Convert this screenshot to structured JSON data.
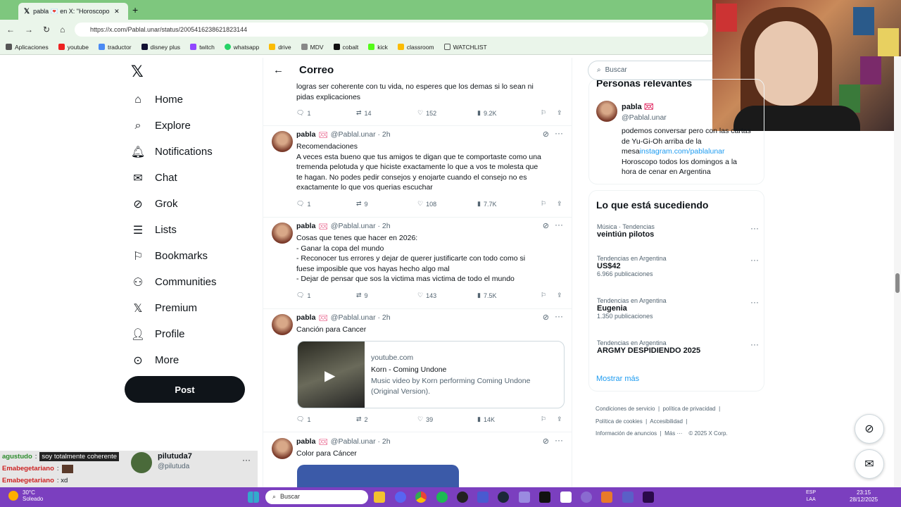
{
  "browser": {
    "tab_title": "pabla 💌 en X: \"Horoscopo Se",
    "url": "https://x.com/Pablal.unar/status/2005416238621823144",
    "bookmarks": [
      "Aplicaciones",
      "youtube",
      "traductor",
      "disney plus",
      "twitch",
      "whatsapp",
      "drive",
      "MDV",
      "cobalt",
      "kick",
      "classroom",
      "WATCHLIST"
    ]
  },
  "nav": {
    "items": [
      {
        "label": "Home",
        "icon": "home-icon"
      },
      {
        "label": "Explore",
        "icon": "search-icon"
      },
      {
        "label": "Notifications",
        "icon": "bell-icon"
      },
      {
        "label": "Chat",
        "icon": "mail-icon"
      },
      {
        "label": "Grok",
        "icon": "grok-icon"
      },
      {
        "label": "Lists",
        "icon": "list-icon"
      },
      {
        "label": "Bookmarks",
        "icon": "bookmark-icon"
      },
      {
        "label": "Communities",
        "icon": "people-icon"
      },
      {
        "label": "Premium",
        "icon": "x-icon"
      },
      {
        "label": "Profile",
        "icon": "person-icon"
      },
      {
        "label": "More",
        "icon": "more-icon"
      }
    ],
    "post_label": "Post"
  },
  "main": {
    "title": "Correo",
    "first_snippet": {
      "body": "logras ser coherente con tu vida, no esperes que los demas si lo sean ni\npidas explicaciones",
      "replies": "1",
      "reposts": "14",
      "likes": "152",
      "views": "9.2K"
    },
    "tweets": [
      {
        "name": "pabla",
        "handle": "@Pablal.unar · 2h",
        "body": "Recomendaciones\nA veces esta bueno que tus amigos te digan que te comportaste como una\ntremenda pelotuda y que hiciste exactamente lo que a vos te molesta que\nte hagan. No podes pedir consejos y enojarte cuando el consejo no es\nexactamente lo que vos querias escuchar",
        "replies": "1",
        "reposts": "9",
        "likes": "108",
        "views": "7.7K"
      },
      {
        "name": "pabla",
        "handle": "@Pablal.unar · 2h",
        "body": "Cosas que tenes que hacer en 2026:\n- Ganar la copa del mundo\n- Reconocer tus errores y dejar de querer justificarte con todo como si\nfuese imposible que vos hayas hecho algo mal\n- Dejar de pensar que sos la victima mas victima de todo el mundo",
        "replies": "1",
        "reposts": "9",
        "likes": "143",
        "views": "7.5K"
      },
      {
        "name": "pabla",
        "handle": "@Pablal.unar · 2h",
        "body": "Canción para Cancer",
        "card": {
          "domain": "youtube.com",
          "title": "Korn - Coming Undone",
          "desc": "Music video by Korn performing Coming Undone\n(Original Version)."
        },
        "replies": "1",
        "reposts": "2",
        "likes": "39",
        "views": "14K"
      },
      {
        "name": "pabla",
        "handle": "@Pablal.unar · 2h",
        "body": "Color para Cáncer"
      }
    ]
  },
  "right": {
    "search_placeholder": "Buscar",
    "relevant_title": "Personas relevantes",
    "relevant_user": {
      "name": "pabla",
      "handle": "@Pablal.unar",
      "bio_1": "podemos conversar pero con las cartas de Yu-Gi-Oh arriba de la mesa",
      "bio_link": "instagram.com/pablalunar",
      "bio_2": "Horoscopo todos los domingos a la hora de cenar en Argentina"
    },
    "trending_title": "Lo que está sucediendo",
    "trends": [
      {
        "meta": "Música · Tendencias",
        "name": "veintiún pilotos",
        "count": ""
      },
      {
        "meta": "Tendencias en Argentina",
        "name": "US$42",
        "count": "6.966 publicaciones"
      },
      {
        "meta": "Tendencias en Argentina",
        "name": "Eugenia",
        "count": "1.350 publicaciones"
      },
      {
        "meta": "Tendencias en Argentina",
        "name": "ARGMY DESPIDIENDO 2025",
        "count": ""
      }
    ],
    "show_more": "Mostrar más",
    "footer": {
      "line1": [
        "Condiciones de servicio",
        "política de privacidad"
      ],
      "line2": [
        "Política de cookies",
        "Accesibilidad"
      ],
      "line3": [
        "Información de anuncios",
        "Más ···",
        "© 2025 X Corp."
      ]
    }
  },
  "chat_overlay": {
    "lines": [
      {
        "user": "agustudo",
        "msg": "soy totalmente coherente"
      },
      {
        "user": "Emabegetariano",
        "msg": ""
      },
      {
        "user": "Emabegetariano",
        "msg": ": xd"
      }
    ],
    "card_name": "pilutuda7",
    "card_handle": "@pilutuda"
  },
  "taskbar": {
    "temp": "30°C",
    "weather": "Soleado",
    "search": "Buscar",
    "lang1": "ESP",
    "lang2": "LAA",
    "time": "23:15",
    "date": "28/12/2025"
  },
  "colors": {
    "accent": "#1d9bf0",
    "tabbar": "#7ec77e",
    "taskbar": "#7b3fbf"
  }
}
